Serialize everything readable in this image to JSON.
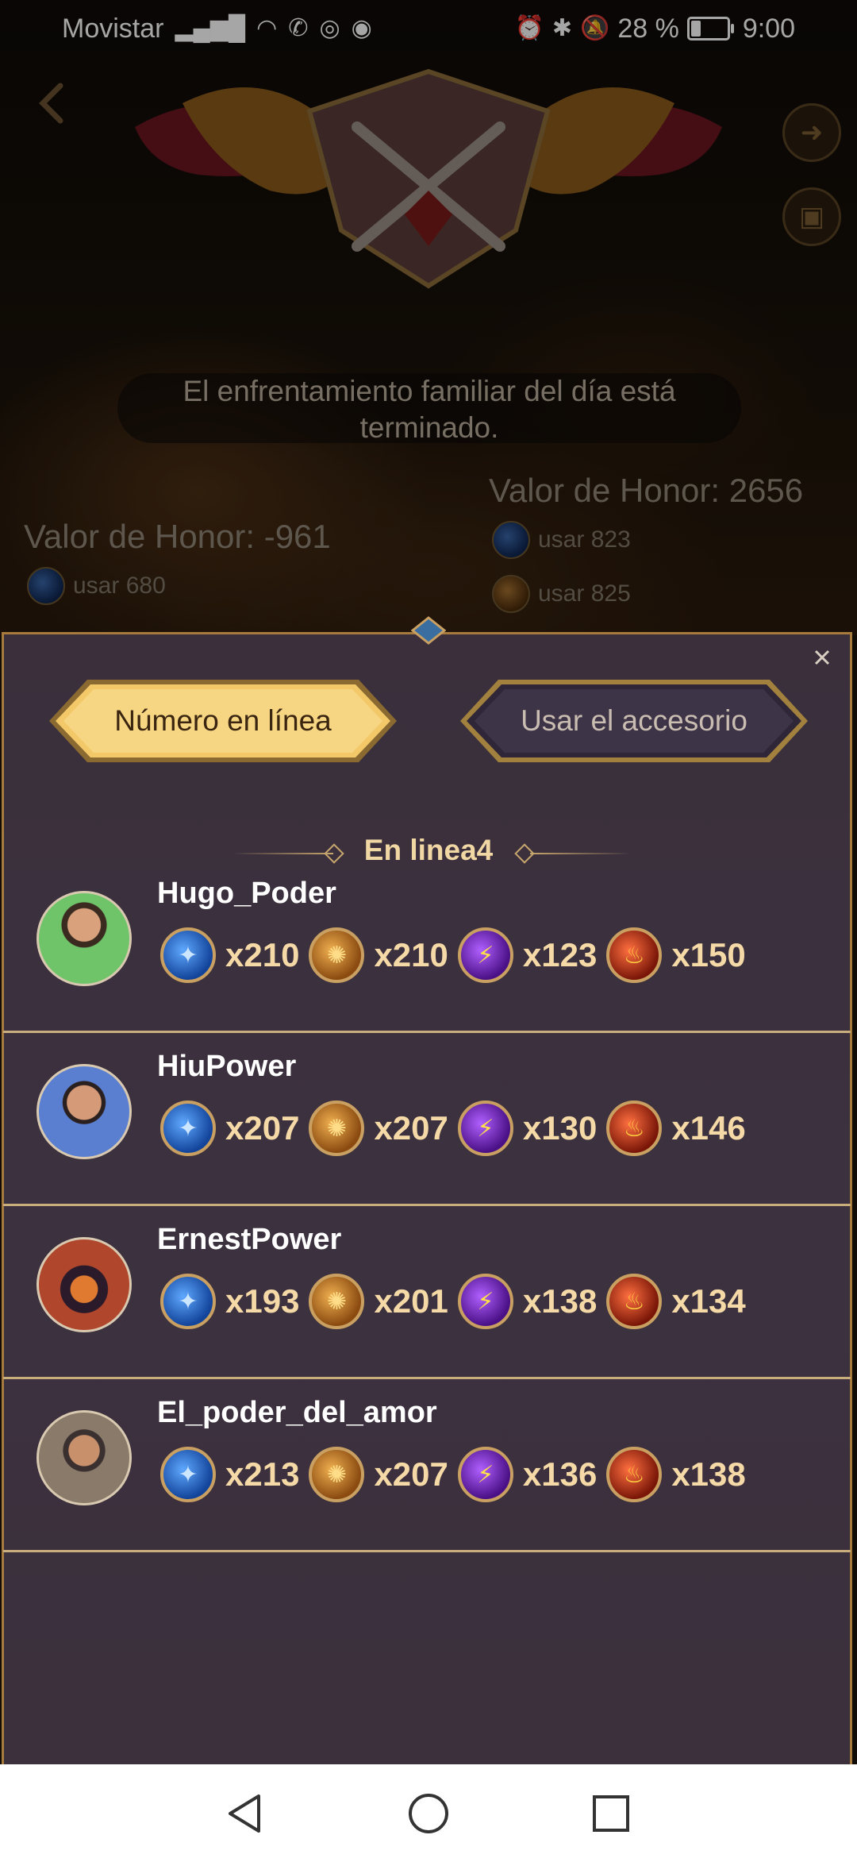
{
  "status_bar": {
    "carrier": "Movistar",
    "battery_text": "28 %",
    "battery_level": 0.28,
    "time": "9:00"
  },
  "header": {
    "back_icon": "chevron-left-icon",
    "share_icon": "share-arrow-icon",
    "gift_icon": "gift-box-icon"
  },
  "battle": {
    "notice": "El enfrentamiento familiar del día está terminado.",
    "left": {
      "honor": "Valor de Honor: -961",
      "uses": [
        {
          "label": "usar 680",
          "icon": "blue-orb-icon"
        }
      ]
    },
    "right": {
      "honor": "Valor de Honor: 2656",
      "uses": [
        {
          "label": "usar 823",
          "icon": "blue-orb-icon"
        },
        {
          "label": "usar 825",
          "icon": "gold-orb-icon"
        }
      ]
    }
  },
  "panel": {
    "tabs": [
      {
        "label": "Número en línea",
        "active": true
      },
      {
        "label": "Usar el accesorio",
        "active": false
      }
    ],
    "section_title": "En linea4",
    "members": [
      {
        "name": "Hugo_Poder",
        "avatar_color": "#6fc46a",
        "items": [
          "x210",
          "x210",
          "x123",
          "x150"
        ]
      },
      {
        "name": "HiuPower",
        "avatar_color": "#5b7fd0",
        "items": [
          "x207",
          "x207",
          "x130",
          "x146"
        ]
      },
      {
        "name": "ErnestPower",
        "avatar_color": "#b0462c",
        "items": [
          "x193",
          "x201",
          "x138",
          "x134"
        ]
      },
      {
        "name": "El_poder_del_amor",
        "avatar_color": "#8a7a6a",
        "items": [
          "x213",
          "x207",
          "x136",
          "x138"
        ]
      }
    ],
    "item_icons": [
      "blue-orb-icon",
      "gold-orb-icon",
      "purple-orb-icon",
      "red-flame-orb-icon"
    ]
  },
  "colors": {
    "panel_bg": "#3b303c",
    "accent_gold": "#f0d7a4",
    "divider": "#c9ad7c"
  }
}
